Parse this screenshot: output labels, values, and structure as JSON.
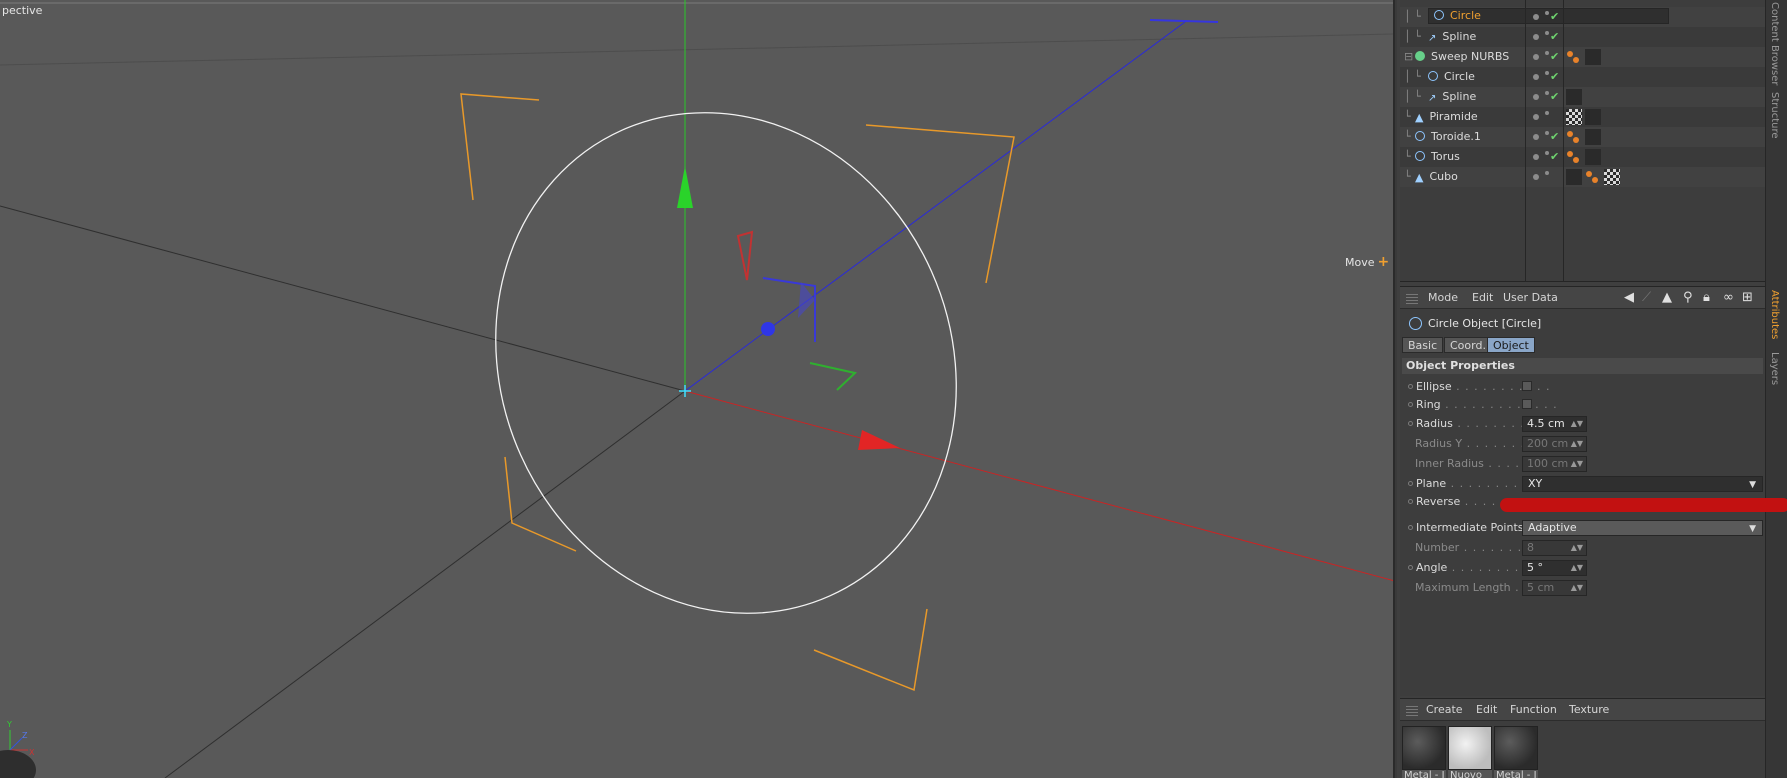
{
  "viewport": {
    "title": "pective",
    "move_label": "Move",
    "move_symbol": "+",
    "axis_labels": {
      "y": "Y",
      "z": "Z",
      "x": "X"
    }
  },
  "object_manager": {
    "rows": [
      {
        "name": "Circle",
        "icon": "circle-icon",
        "indent": 1,
        "selected": true
      },
      {
        "name": "Spline",
        "icon": "spline-icon",
        "indent": 1
      },
      {
        "name": "Sweep NURBS",
        "icon": "nurbs-icon",
        "indent": 0
      },
      {
        "name": "Circle",
        "icon": "circle-icon",
        "indent": 1
      },
      {
        "name": "Spline",
        "icon": "spline-icon",
        "indent": 1
      },
      {
        "name": "Piramide",
        "icon": "pyramid-icon",
        "indent": 0
      },
      {
        "name": "Toroide.1",
        "icon": "torus-icon",
        "indent": 0
      },
      {
        "name": "Torus",
        "icon": "torus-icon",
        "indent": 0
      },
      {
        "name": "Cubo",
        "icon": "cube-icon",
        "indent": 0
      }
    ]
  },
  "side_tabs": [
    "Content Browser",
    "Structure",
    "Attributes",
    "Layers"
  ],
  "attributes": {
    "menu": [
      "Mode",
      "Edit",
      "User Data"
    ],
    "object_title": "Circle Object [Circle]",
    "tabs": [
      "Basic",
      "Coord.",
      "Object"
    ],
    "active_tab": "Object",
    "section_title": "Object Properties",
    "props": {
      "ellipse": "Ellipse",
      "ring": "Ring",
      "radius": "Radius",
      "radius_value": "4.5 cm",
      "radius_y": "Radius Y",
      "radius_y_value": "200 cm",
      "inner_radius": "Inner Radius",
      "inner_radius_value": "100 cm",
      "plane": "Plane",
      "plane_value": "XY",
      "reverse": "Reverse",
      "intermediate_points": "Intermediate Points",
      "intermediate_points_value": "Adaptive",
      "number": "Number",
      "number_value": "8",
      "angle": "Angle",
      "angle_value": "5 °",
      "max_length": "Maximum Length",
      "max_length_value": "5 cm"
    }
  },
  "material_manager": {
    "menu": [
      "Create",
      "Edit",
      "Function",
      "Texture"
    ],
    "materials": [
      "Metal - I",
      "Nuovo",
      "Metal - I"
    ]
  }
}
